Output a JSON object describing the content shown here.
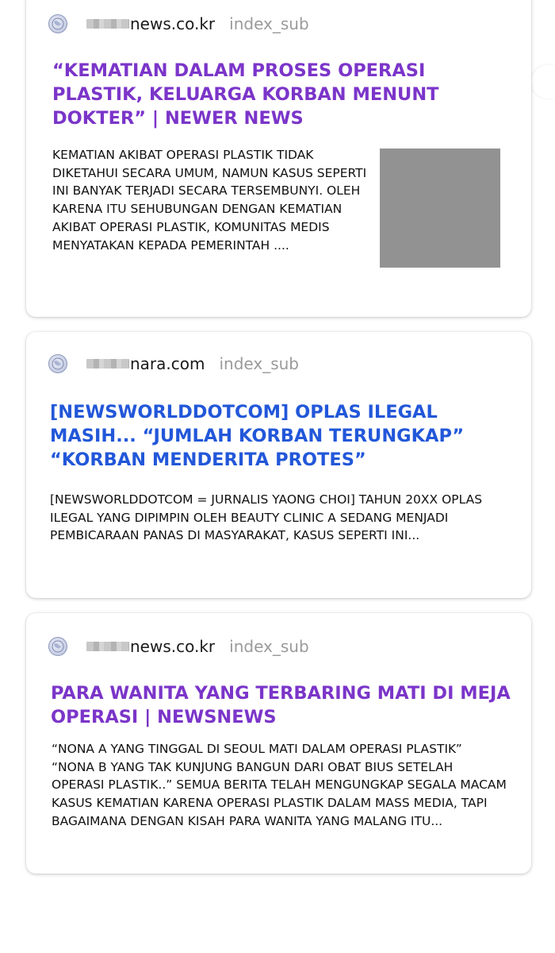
{
  "results": [
    {
      "domain": "news.co.kr",
      "path": "index_sub",
      "title": "“KEMATIAN DALAM PROSES OPERASI PLASTIK, KELUARGA KORBAN MENUNT DOKTER” | NEWER NEWS",
      "title_color": "#7b35c9",
      "snippet": "KEMATIAN AKIBAT OPERASI PLASTIK TIDAK DIKETAHUI SECARA UMUM, NAMUN KASUS SEPERTI INI BANYAK TERJADI SECARA TERSEMBUNYI. OLEH KARENA ITU SEHUBUNGAN DENGAN KEMATIAN AKIBAT OPERASI PLASTIK, KOMUNITAS MEDIS MENYATAKAN KEPADA PEMERINTAH ....",
      "has_thumbnail": true
    },
    {
      "domain": "nara.com",
      "path": "index_sub",
      "title": "[NEWSWORLDDOTCOM] OPLAS ILEGAL MASIH... “JUMLAH KORBAN TERUNGKAP” “KORBAN MENDERITA PROTES”",
      "title_color": "#2257d9",
      "snippet": "[NEWSWORLDDOTCOM = JURNALIS YAONG CHOI] TAHUN 20XX OPLAS ILEGAL YANG DIPIMPIN OLEH BEAUTY CLINIC A SEDANG MENJADI PEMBICARAAN PANAS DI MASYARAKAT, KASUS SEPERTI INI...",
      "has_thumbnail": false
    },
    {
      "domain": "news.co.kr",
      "path": "index_sub",
      "title": "PARA WANITA YANG TERBARING MATI DI MEJA OPERASI | NEWSNEWS",
      "title_color": "#7b35c9",
      "snippet": "“NONA A YANG TINGGAL DI SEOUL MATI DALAM OPERASI PLASTIK” “NONA B YANG TAK KUNJUNG BANGUN DARI OBAT BIUS SETELAH OPERASI PLASTIK..” SEMUA BERITA TELAH MENGUNGKAP SEGALA MACAM KASUS KEMATIAN KARENA OPERASI PLASTIK DALAM MASS MEDIA, TAPI BAGAIMANA DENGAN KISAH PARA WANITA YANG MALANG ITU...",
      "has_thumbnail": false
    }
  ],
  "icons": {
    "site": "globe-icon",
    "redacted": "redacted-domain-prefix"
  }
}
